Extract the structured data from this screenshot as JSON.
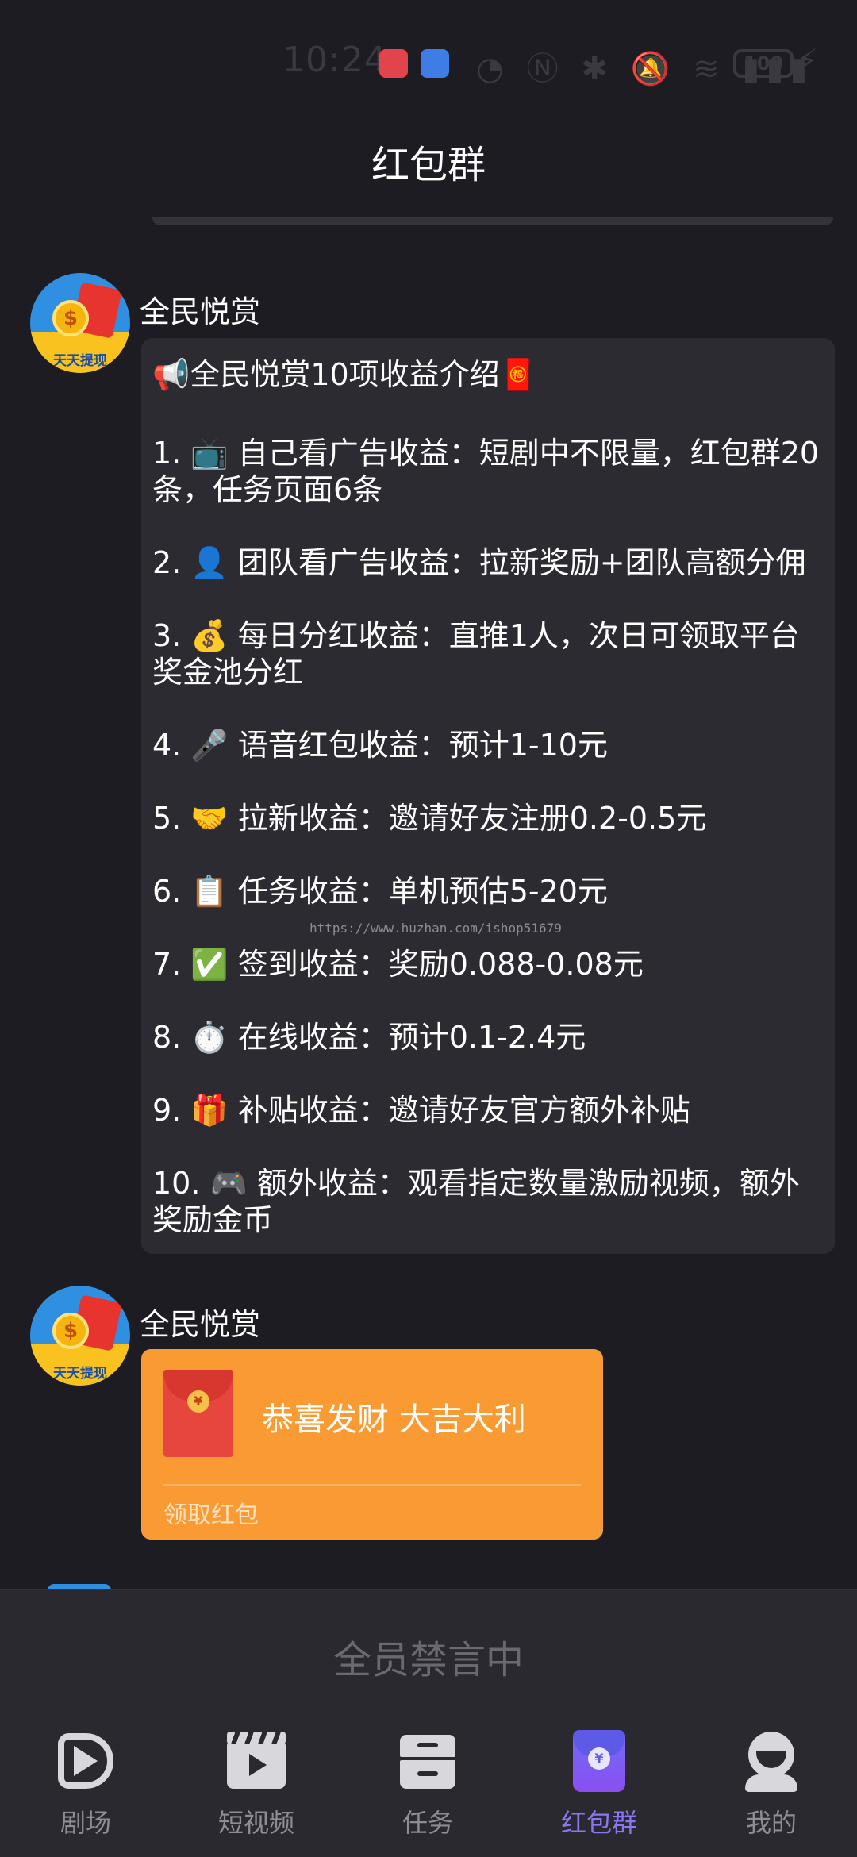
{
  "status_bar": {
    "time": "10:24",
    "icons": "◔ Ⓝ ✱ 🔕 ≋ ▮▮▮",
    "battery": "100",
    "charge": "⚡"
  },
  "header": {
    "title": "红包群"
  },
  "messages": [
    {
      "sender": "全民悦赏",
      "avatar_caption": "天天提现",
      "title": "📢全民悦赏10项收益介绍🧧",
      "items": [
        "1. 📺 自己看广告收益：短剧中不限量，红包群20条，任务页面6条",
        "2. 👤 团队看广告收益：拉新奖励+团队高额分佣",
        "3. 💰 每日分红收益：直推1人，次日可领取平台奖金池分红",
        "4. 🎤 语音红包收益：预计1-10元",
        "5. 🤝 拉新收益：邀请好友注册0.2-0.5元",
        "6. 📋 任务收益：单机预估5-20元",
        "7. ✅ 签到收益：奖励0.088-0.08元",
        "8. ⏱️ 在线收益：预计0.1-2.4元",
        "9. 🎁 补贴收益：邀请好友官方额外补贴",
        "10. 🎮 额外收益：观看指定数量激励视频，额外奖励金币"
      ]
    },
    {
      "sender": "全民悦赏",
      "avatar_caption": "天天提现",
      "red_packet": {
        "title": "恭喜发财 大吉大利",
        "action": "领取红包",
        "seal": "¥"
      }
    }
  ],
  "watermark": "https://www.huzhan.com/ishop51679",
  "mute_bar": {
    "text": "全员禁言中"
  },
  "tabs": [
    {
      "label": "剧场",
      "icon": "play-icon",
      "active": false
    },
    {
      "label": "短视频",
      "icon": "clapperboard-icon",
      "active": false
    },
    {
      "label": "任务",
      "icon": "task-box-icon",
      "active": false
    },
    {
      "label": "红包群",
      "icon": "red-packet-icon",
      "active": true
    },
    {
      "label": "我的",
      "icon": "profile-icon",
      "active": false
    }
  ],
  "colors": {
    "background": "#1d1c22",
    "bubble": "#2c2b32",
    "packet": "#f99b32",
    "active_tab": "#8a78f2"
  }
}
